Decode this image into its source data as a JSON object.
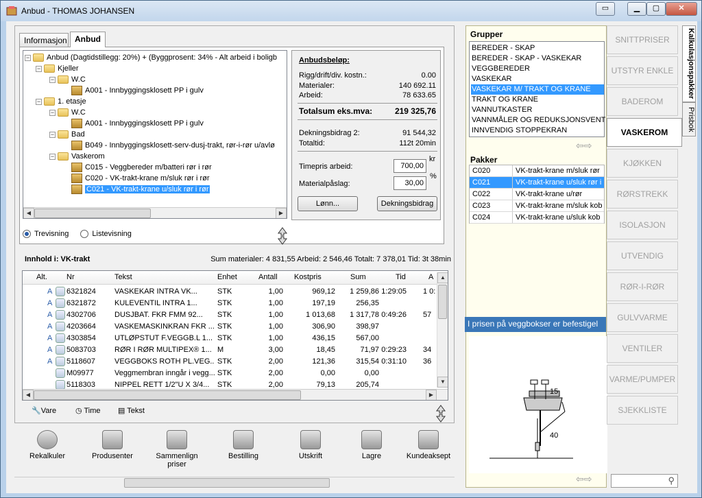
{
  "window": {
    "title": "Anbud - THOMAS JOHANSEN"
  },
  "tabs": [
    {
      "label": "Informasjon"
    },
    {
      "label": "Anbud"
    }
  ],
  "tree": {
    "nodes": [
      {
        "text": "Anbud (Dagtidstillegg: 20%) + (Byggprosent: 34% - Alt arbeid i boligb"
      },
      {
        "text": "Kjeller"
      },
      {
        "text": "W.C"
      },
      {
        "text": "A001 - Innbyggingsklosett  PP i gulv"
      },
      {
        "text": "1. etasje"
      },
      {
        "text": "W.C"
      },
      {
        "text": "A001 - Innbyggingsklosett  PP i gulv"
      },
      {
        "text": "Bad"
      },
      {
        "text": "B049 - Innbyggingsklosett-serv-dusj-trakt, rør-i-rør u/avlø"
      },
      {
        "text": "Vaskerom"
      },
      {
        "text": "C015 - Veggbereder m/batteri rør i rør"
      },
      {
        "text": "C020 - VK-trakt-krane m/sluk rør i rør"
      },
      {
        "text": "C021 - VK-trakt-krane u/sluk rør i rør"
      }
    ]
  },
  "bid": {
    "heading": "Anbudsbeløp:",
    "rows": [
      {
        "label": "Rigg/drift/div. kostn.:",
        "value": "0.00"
      },
      {
        "label": "Materialer:",
        "value": "140 692.11"
      },
      {
        "label": "Arbeid:",
        "value": "78 633.65"
      }
    ],
    "total_label": "Totalsum eks.mva:",
    "total_value": "219 325,76",
    "db2_label": "Dekningsbidrag 2:",
    "db2_value": "91 544,32",
    "tid_label": "Totaltid:",
    "tid_value": "112t 20min",
    "timepris_label": "Timepris arbeid:",
    "timepris_value": "700,00",
    "timepris_unit": "kr",
    "mat_label": "Materialpåslag:",
    "mat_value": "30,00",
    "mat_unit": "%",
    "lonn_btn": "Lønn...",
    "db_btn": "Dekningsbidrag"
  },
  "view": {
    "tree": "Trevisning",
    "list": "Listevisning"
  },
  "content": {
    "title": "Innhold i: VK-trakt",
    "summary": "Sum materialer:  4 831,55  Arbeid:  2 546,46  Totalt:  7 378,01  Tid: 3t 38min",
    "columns": [
      "Alt.",
      "Nr",
      "Tekst",
      "Enhet",
      "Antall",
      "Kostpris",
      "Sum",
      "Tid",
      "A"
    ],
    "rows": [
      {
        "alt": "A",
        "nr": "6321824",
        "tekst": "VASKEKAR       INTRA VK...",
        "enhet": "STK",
        "antall": "1,00",
        "kost": "969,12",
        "sum": "1 259,86",
        "tid": "1:29:05",
        "a": "1 0:"
      },
      {
        "alt": "A",
        "nr": "6321872",
        "tekst": "KULEVENTIL      INTRA 1...",
        "enhet": "STK",
        "antall": "1,00",
        "kost": "197,19",
        "sum": "256,35",
        "tid": "",
        "a": ""
      },
      {
        "alt": "A",
        "nr": "4302706",
        "tekst": "DUSJBAT. FKR    FMM 92...",
        "enhet": "STK",
        "antall": "1,00",
        "kost": "1 013,68",
        "sum": "1 317,78",
        "tid": "0:49:26",
        "a": "57"
      },
      {
        "alt": "A",
        "nr": "4203664",
        "tekst": "VASKEMASKINKRAN FKR ...",
        "enhet": "STK",
        "antall": "1,00",
        "kost": "306,90",
        "sum": "398,97",
        "tid": "",
        "a": ""
      },
      {
        "alt": "A",
        "nr": "4303854",
        "tekst": "UTLØPSTUT F.VEGGB.L 1...",
        "enhet": "STK",
        "antall": "1,00",
        "kost": "436,15",
        "sum": "567,00",
        "tid": "",
        "a": ""
      },
      {
        "alt": "A",
        "nr": "5083703",
        "tekst": "RØR I RØR MULTIPEX® 1...",
        "enhet": "M",
        "antall": "3,00",
        "kost": "18,45",
        "sum": "71,97",
        "tid": "0:29:23",
        "a": "34"
      },
      {
        "alt": "A",
        "nr": "5118607",
        "tekst": "VEGGBOKS ROTH PL.VEG...",
        "enhet": "STK",
        "antall": "2,00",
        "kost": "121,36",
        "sum": "315,54",
        "tid": "0:31:10",
        "a": "36"
      },
      {
        "alt": "",
        "nr": "M09977",
        "tekst": "Veggmembran inngår i vegg...",
        "enhet": "STK",
        "antall": "2,00",
        "kost": "0,00",
        "sum": "0,00",
        "tid": "",
        "a": ""
      },
      {
        "alt": "",
        "nr": "5118303",
        "tekst": "NIPPEL RETT 1/2\"U X 3/4...",
        "enhet": "STK",
        "antall": "2,00",
        "kost": "79,13",
        "sum": "205,74",
        "tid": "",
        "a": ""
      }
    ]
  },
  "legend": {
    "vare": "Vare",
    "time": "Time",
    "tekst": "Tekst"
  },
  "toolbar": [
    {
      "label": "Rekalkuler"
    },
    {
      "label": "Produsenter"
    },
    {
      "label": "Sammenlign priser"
    },
    {
      "label": "Bestilling"
    },
    {
      "label": "Utskrift"
    },
    {
      "label": "Lagre"
    },
    {
      "label": "Kundeaksept"
    }
  ],
  "groups": {
    "title": "Grupper",
    "items": [
      "BEREDER - SKAP",
      "BEREDER - SKAP - VASKEKAR",
      "VEGGBEREDER",
      "VASKEKAR",
      "VASKEKAR M/ TRAKT OG KRANE",
      "TRAKT OG KRANE",
      "VANNUTKASTER",
      "VANNMÅLER OG REDUKSJONSVENT",
      "INNVENDIG STOPPEKRAN"
    ],
    "selected_index": 4
  },
  "packages": {
    "title": "Pakker",
    "rows": [
      {
        "code": "C020",
        "name": "VK-trakt-krane m/sluk rør"
      },
      {
        "code": "C021",
        "name": "VK-trakt-krane u/sluk rør i"
      },
      {
        "code": "C022",
        "name": "VK-trakt-krane u/rør"
      },
      {
        "code": "C023",
        "name": "VK-trakt-krane m/sluk kob"
      },
      {
        "code": "C024",
        "name": "VK-trakt-krane u/sluk kob"
      }
    ],
    "selected_index": 1
  },
  "note": "I prisen på veggbokser er befestigel",
  "drawing": {
    "dim1": "15",
    "dim2": "40"
  },
  "categories": [
    "SNITTPRISER",
    "UTSTYR ENKLE",
    "BADEROM",
    "VASKEROM",
    "KJØKKEN",
    "RØRSTREKK",
    "ISOLASJON",
    "UTVENDIG",
    "RØR-I-RØR",
    "GULVVARME",
    "VENTILER",
    "VARME/PUMPER",
    "SJEKKLISTE"
  ],
  "active_category": "VASKEROM",
  "side_tabs": {
    "kalk": "Kalkulasjonspakker",
    "pris": "Prisbok"
  }
}
